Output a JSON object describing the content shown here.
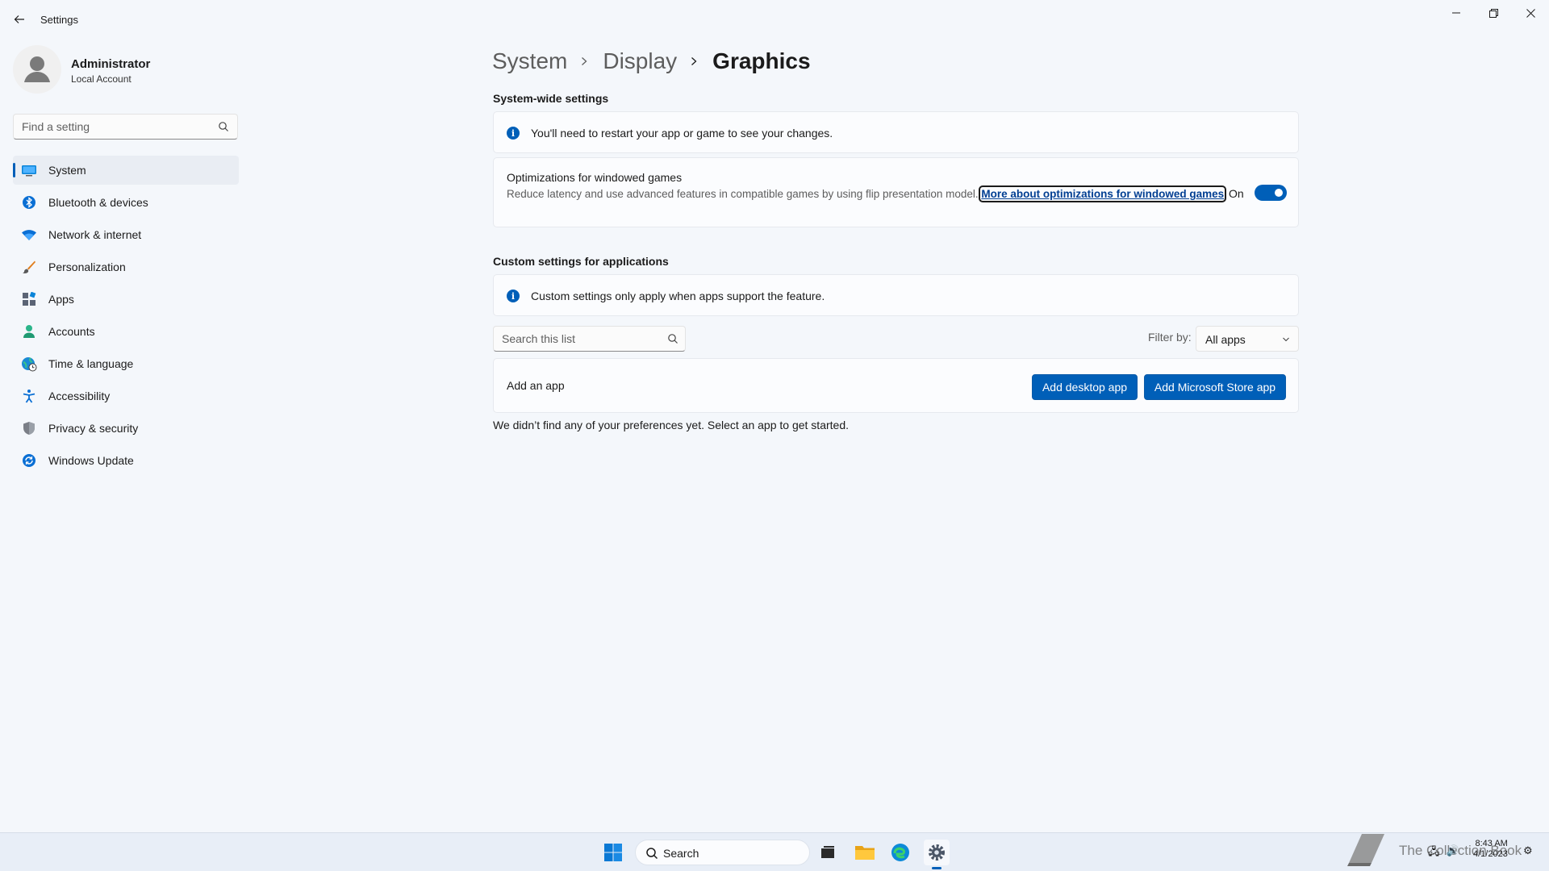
{
  "window": {
    "title": "Settings"
  },
  "profile": {
    "name": "Administrator",
    "account_type": "Local Account"
  },
  "sidebar": {
    "search_placeholder": "Find a setting",
    "items": [
      {
        "label": "System",
        "icon": "system-icon",
        "selected": true
      },
      {
        "label": "Bluetooth & devices",
        "icon": "bluetooth-icon"
      },
      {
        "label": "Network & internet",
        "icon": "wifi-icon"
      },
      {
        "label": "Personalization",
        "icon": "brush-icon"
      },
      {
        "label": "Apps",
        "icon": "apps-icon"
      },
      {
        "label": "Accounts",
        "icon": "person-icon"
      },
      {
        "label": "Time & language",
        "icon": "globe-clock-icon"
      },
      {
        "label": "Accessibility",
        "icon": "accessibility-icon"
      },
      {
        "label": "Privacy & security",
        "icon": "shield-icon"
      },
      {
        "label": "Windows Update",
        "icon": "update-icon"
      }
    ]
  },
  "breadcrumb": {
    "items": [
      "System",
      "Display",
      "Graphics"
    ]
  },
  "system_wide": {
    "title": "System-wide settings",
    "info": "You'll need to restart your app or game to see your changes.",
    "optimizations": {
      "title": "Optimizations for windowed games",
      "description": "Reduce latency and use advanced features in compatible games by using flip presentation model.",
      "link": "More about optimizations for windowed games",
      "toggle_label": "On",
      "toggle_on": true
    }
  },
  "custom": {
    "title": "Custom settings for applications",
    "info": "Custom settings only apply when apps support the feature.",
    "search_placeholder": "Search this list",
    "filter_label": "Filter by:",
    "filter_value": "All apps",
    "add_label": "Add an app",
    "add_desktop_button": "Add desktop app",
    "add_store_button": "Add Microsoft Store app",
    "empty_message": "We didn’t find any of your preferences yet. Select an app to get started."
  },
  "taskbar": {
    "search_label": "Search",
    "watermark": "The Collection Book",
    "clock_time": "8:43 AM",
    "clock_date": "4/1/2023"
  },
  "colors": {
    "accent": "#005fb8",
    "background": "#f4f7fb"
  }
}
